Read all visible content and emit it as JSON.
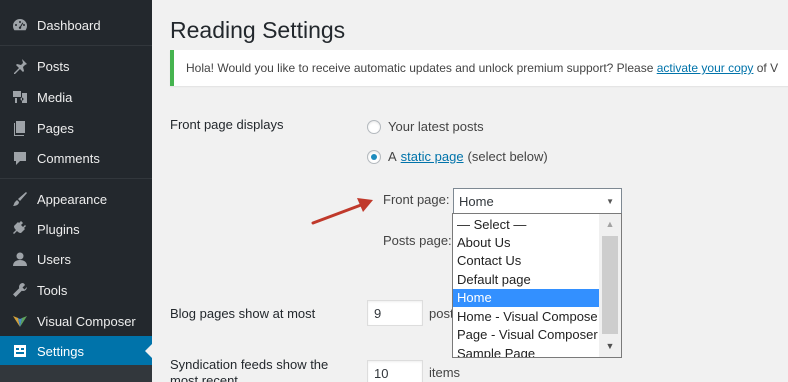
{
  "sidebar": {
    "items": [
      {
        "label": "Dashboard",
        "icon": "dashboard-icon"
      },
      {
        "label": "Posts",
        "icon": "pin-icon"
      },
      {
        "label": "Media",
        "icon": "media-icon"
      },
      {
        "label": "Pages",
        "icon": "pages-icon"
      },
      {
        "label": "Comments",
        "icon": "comment-icon"
      },
      {
        "label": "Appearance",
        "icon": "brush-icon"
      },
      {
        "label": "Plugins",
        "icon": "plugin-icon"
      },
      {
        "label": "Users",
        "icon": "user-icon"
      },
      {
        "label": "Tools",
        "icon": "wrench-icon"
      },
      {
        "label": "Visual Composer",
        "icon": "visual-composer-icon"
      },
      {
        "label": "Settings",
        "icon": "settings-icon",
        "current": true
      }
    ],
    "accent": "#0073aa",
    "background": "#23282d"
  },
  "page": {
    "title": "Reading Settings"
  },
  "notice": {
    "text": "Hola! Would you like to receive automatic updates and unlock premium support? Please ",
    "link": "activate your copy",
    "suffix": " of V",
    "accent": "#46b450"
  },
  "front_page_displays": {
    "label": "Front page displays",
    "option_latest": "Your latest posts",
    "option_static_prefix": "A",
    "option_static_link": "static page",
    "option_static_suffix": "(select below)",
    "selected": "static"
  },
  "front_page": {
    "label": "Front page:",
    "value": "Home",
    "options": [
      "— Select —",
      "About Us",
      "Contact Us",
      "Default page",
      "Home",
      "Home - Visual Compose",
      "Page - Visual Composer",
      "Sample Page"
    ],
    "selected_option": "Home"
  },
  "posts_page": {
    "label": "Posts page:"
  },
  "blog_pages": {
    "label": "Blog pages show at most",
    "value": "9",
    "unit": "posts"
  },
  "syndication": {
    "label": "Syndication feeds show the most recent",
    "value": "10",
    "unit": "items"
  },
  "annotation": {
    "arrow_color": "#c0392b"
  }
}
